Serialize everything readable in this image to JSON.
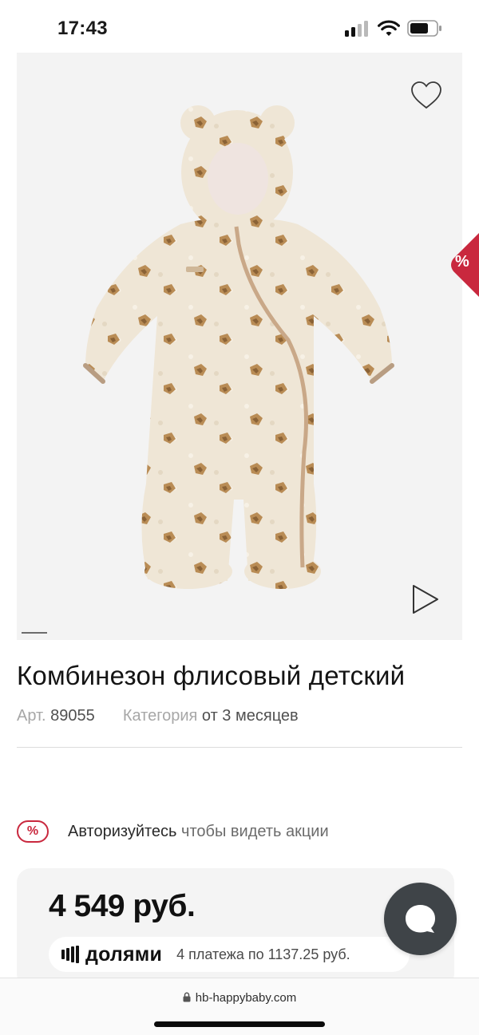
{
  "status_bar": {
    "time": "17:43",
    "icons": [
      "cellular-signal-icon",
      "wifi-icon",
      "battery-icon"
    ]
  },
  "product": {
    "title": "Комбинезон флисовый детский",
    "article_label": "Арт.",
    "article_value": "89055",
    "category_label": "Категория",
    "category_value": "от 3 месяцев",
    "sale_badge": "%"
  },
  "promo": {
    "icon": "%",
    "link_text": "Авторизуйтесь",
    "text": "чтобы видеть акции"
  },
  "price": {
    "value": "4 549 руб.",
    "dolyami_brand": "долями",
    "dolyami_text": "4 платежа по 1137.25 руб."
  },
  "browser": {
    "url": "hb-happybaby.com"
  },
  "colors": {
    "accent": "#c9283e",
    "chat_button": "#3f4448",
    "image_bg": "#f3f3f3"
  },
  "icons": {
    "favorite": "heart-icon",
    "video": "play-icon",
    "chat": "chat-bubble-icon",
    "lock": "lock-icon"
  }
}
